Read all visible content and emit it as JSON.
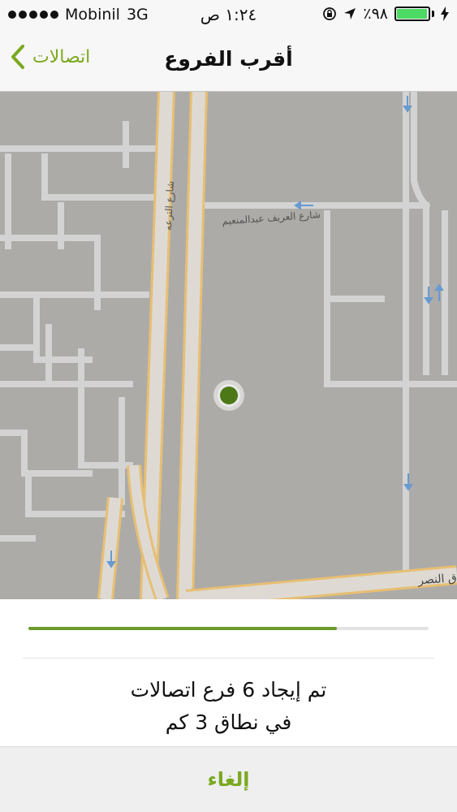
{
  "status_bar": {
    "carrier": "Mobinil",
    "network": "3G",
    "time": "١:٢٤ ص",
    "battery_text": "٪٩٨",
    "battery_level": 0.98
  },
  "nav": {
    "title": "أقرب الفروع",
    "back_label": "اتصالات"
  },
  "map": {
    "street_labels": [
      "شارع الترعه",
      "شارع العريف عبدالمنعيم",
      "ق النصر"
    ]
  },
  "sheet": {
    "progress": 0.77,
    "result_line1": "تم إيجاد 6 فرع اتصالات",
    "result_line2": "في نطاق 3 كم",
    "cancel_label": "إلغاء"
  },
  "colors": {
    "accent": "#7aa920",
    "progress": "#6b9a2d",
    "location_dot": "#4f7c17",
    "battery": "#4cd964"
  }
}
